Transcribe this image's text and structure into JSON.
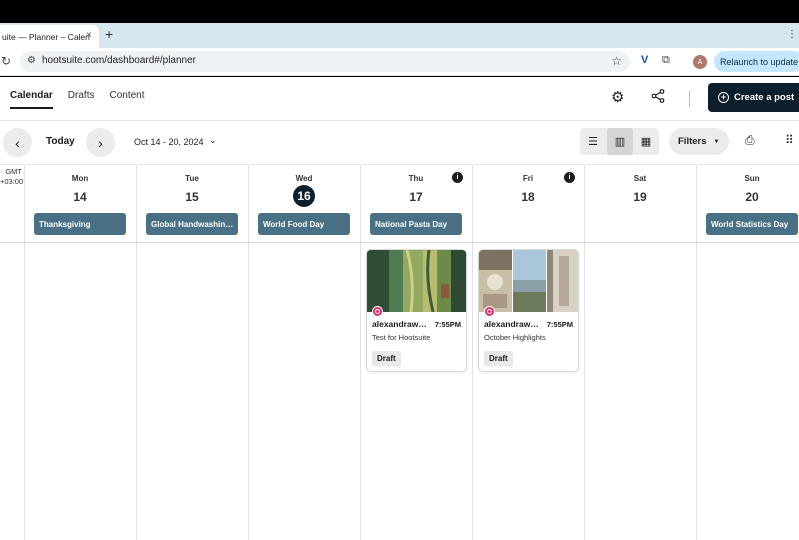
{
  "browser": {
    "tab_title": "uite — Planner – Calen",
    "tab_close": "×",
    "new_tab": "+",
    "tab_right_icon": "⋮",
    "url": "hootsuite.com/dashboard#/planner",
    "avatar_letter": "A",
    "relaunch_label": "Relaunch to update",
    "icons": [
      "reload-icon",
      "tune-icon",
      "star-icon",
      "extension-v-icon",
      "puzzle-icon"
    ]
  },
  "nav": {
    "tabs": [
      {
        "label": "Calendar",
        "active": true
      },
      {
        "label": "Drafts",
        "active": false
      },
      {
        "label": "Content",
        "active": false
      }
    ],
    "create_label": "Create a post"
  },
  "toolbar": {
    "today_label": "Today",
    "prev_icon": "‹",
    "next_icon": "›",
    "date_range": "Oct 14 - 20, 2024",
    "date_range_chevron": "⌄",
    "filters_label": "Filters",
    "filters_chevron": "▼",
    "view_modes": [
      "list-view",
      "week-view",
      "month-view"
    ],
    "active_view": "week-view"
  },
  "calendar": {
    "timezone_line1": "GMT",
    "timezone_line2": "+03:00",
    "days": [
      {
        "name": "Mon",
        "num": "14",
        "holiday": "Thanksgiving",
        "today": false,
        "info": false
      },
      {
        "name": "Tue",
        "num": "15",
        "holiday": "Global Handwashin…",
        "today": false,
        "info": false
      },
      {
        "name": "Wed",
        "num": "16",
        "holiday": "World Food Day",
        "today": true,
        "info": false
      },
      {
        "name": "Thu",
        "num": "17",
        "holiday": "National Pasta Day",
        "today": false,
        "info": true
      },
      {
        "name": "Fri",
        "num": "18",
        "holiday": "",
        "today": false,
        "info": true
      },
      {
        "name": "Sat",
        "num": "19",
        "holiday": "",
        "today": false,
        "info": false
      },
      {
        "name": "Sun",
        "num": "20",
        "holiday": "World Statistics Day",
        "today": false,
        "info": false
      }
    ],
    "info_glyph": "i",
    "posts": [
      {
        "day": "Thu",
        "user": "alexandraw…",
        "time": "7:55PM",
        "caption": "Test for Hootsuite",
        "status": "Draft",
        "network": "instagram"
      },
      {
        "day": "Fri",
        "user": "alexandraw…",
        "time": "7:55PM",
        "caption": "October Highlights",
        "status": "Draft",
        "network": "instagram"
      }
    ]
  },
  "colors": {
    "primary_dark": "#0d1e2c",
    "holiday_bg": "#4a7085",
    "instagram": "#d6336c",
    "relaunch_bg": "#c4e7ff"
  }
}
